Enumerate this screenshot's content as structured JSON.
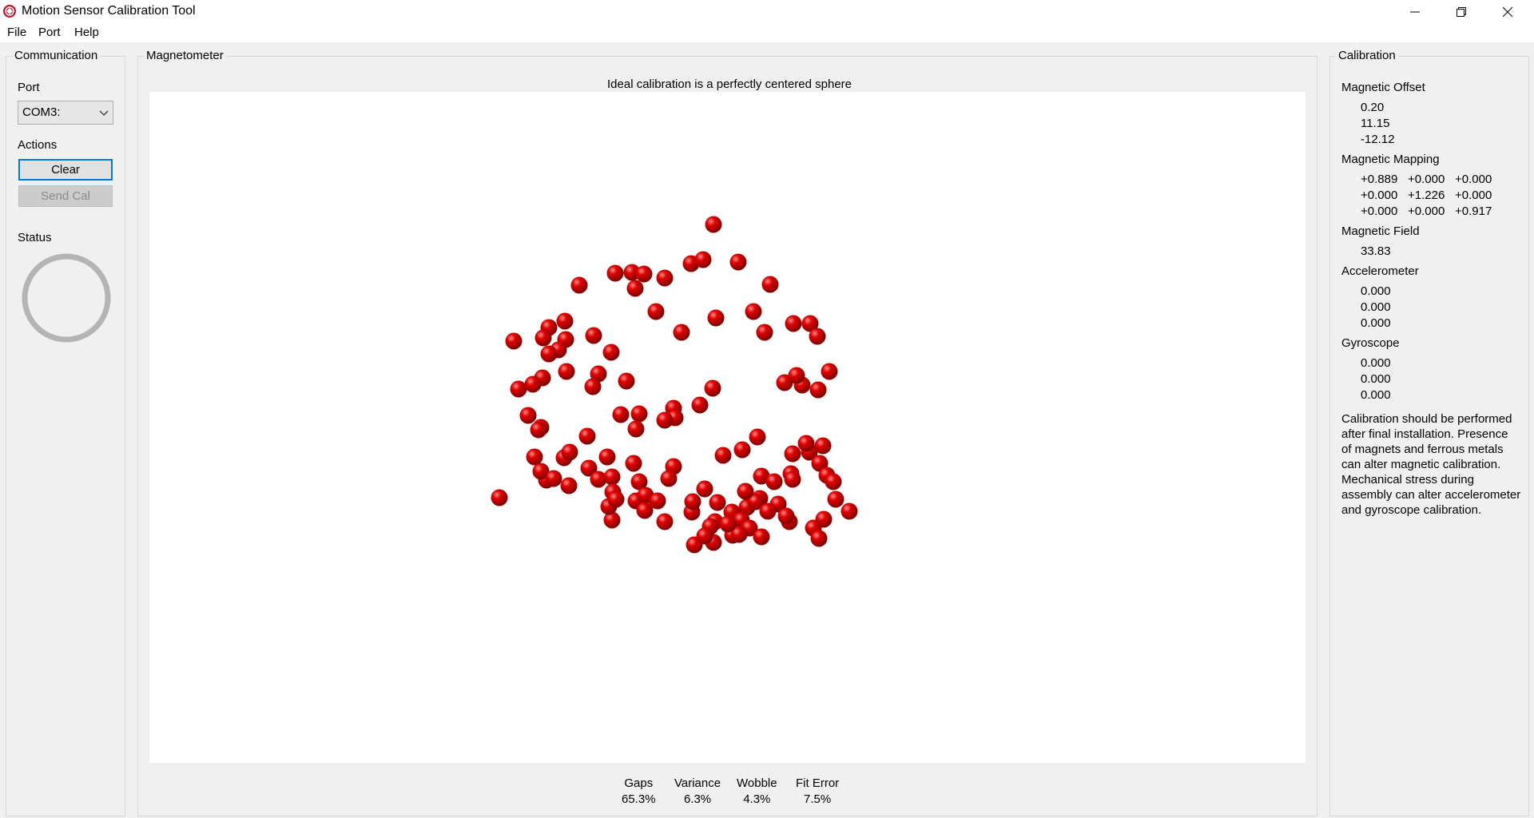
{
  "window": {
    "title": "Motion Sensor Calibration Tool",
    "icon": "app-logo-icon"
  },
  "menu": [
    "File",
    "Port",
    "Help"
  ],
  "communication": {
    "title": "Communication",
    "port_label": "Port",
    "port_value": "COM3:",
    "actions_label": "Actions",
    "clear_label": "Clear",
    "send_cal_label": "Send Cal",
    "status_label": "Status"
  },
  "magnetometer": {
    "title": "Magnetometer",
    "hint": "Ideal calibration is a perfectly centered sphere",
    "stats": [
      {
        "label": "Gaps",
        "value": "65.3%"
      },
      {
        "label": "Variance",
        "value": "6.3%"
      },
      {
        "label": "Wobble",
        "value": "4.3%"
      },
      {
        "label": "Fit Error",
        "value": "7.5%"
      }
    ]
  },
  "calibration": {
    "title": "Calibration",
    "magnetic_offset": {
      "label": "Magnetic Offset",
      "values": [
        "0.20",
        "11.15",
        "-12.12"
      ]
    },
    "magnetic_mapping": {
      "label": "Magnetic Mapping",
      "rows": [
        [
          "+0.889",
          "+0.000",
          "+0.000"
        ],
        [
          "+0.000",
          "+1.226",
          "+0.000"
        ],
        [
          "+0.000",
          "+0.000",
          "+0.917"
        ]
      ]
    },
    "magnetic_field": {
      "label": "Magnetic Field",
      "value": "33.83"
    },
    "accelerometer": {
      "label": "Accelerometer",
      "values": [
        "0.000",
        "0.000",
        "0.000"
      ]
    },
    "gyroscope": {
      "label": "Gyroscope",
      "values": [
        "0.000",
        "0.000",
        "0.000"
      ]
    },
    "note_lines": [
      "Calibration should be performed",
      "after final installation.  Presence",
      "of magnets and ferrous metals",
      "can alter magnetic calibration.",
      "Mechanical stress during",
      "assembly can alter accelerometer",
      "and gyroscope calibration."
    ]
  },
  "colors": {
    "point": "#dd0000",
    "status_ring": "#b4b4b4",
    "focus_border": "#0078d7"
  }
}
